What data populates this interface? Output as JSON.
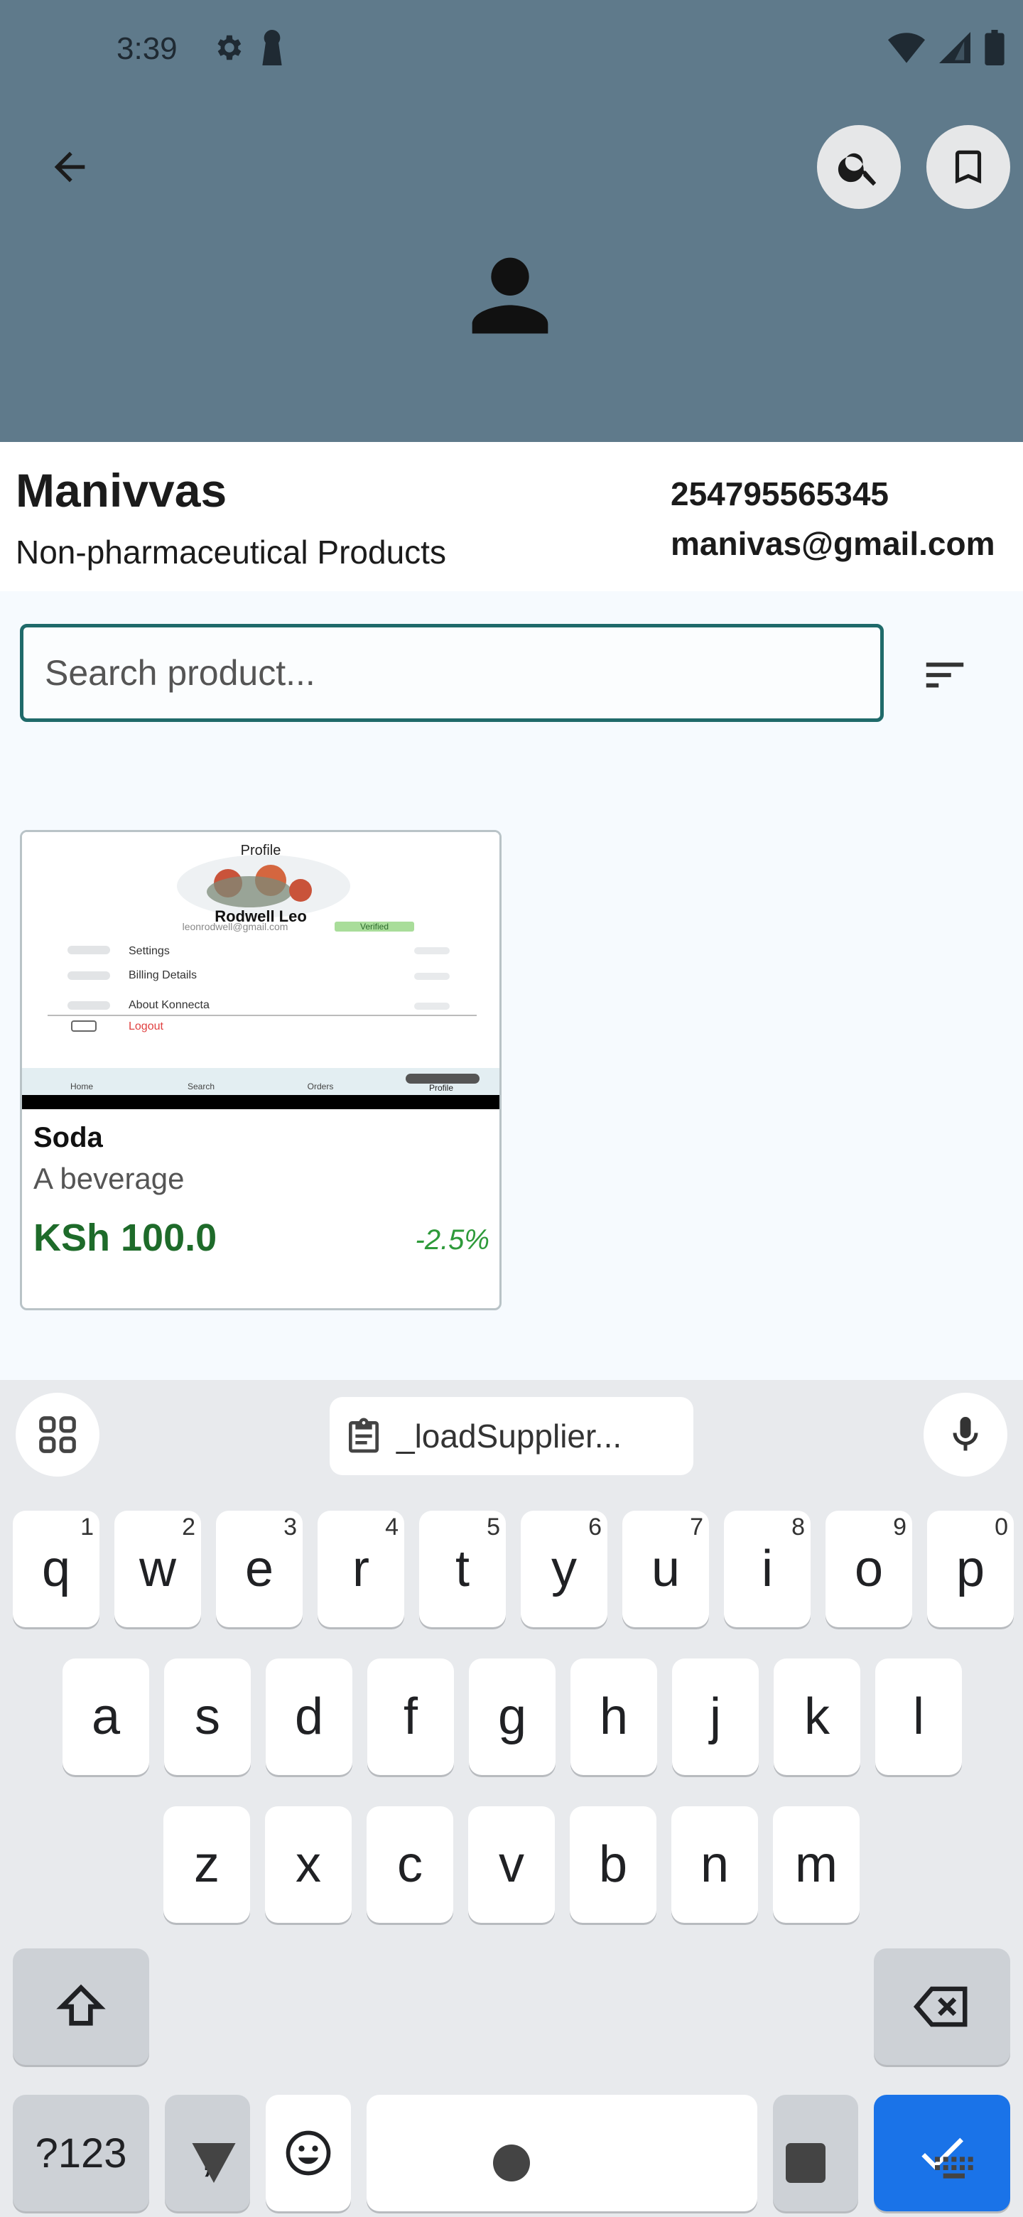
{
  "status_bar": {
    "time": "3:39"
  },
  "header": {
    "back_icon": "arrow-left-icon",
    "search_icon": "search-icon",
    "bookmark_icon": "bookmark-icon",
    "avatar_icon": "person-icon",
    "background": "#5f7a8b"
  },
  "supplier": {
    "name": "Manivvas",
    "category": "Non-pharmaceutical Products",
    "phone": "254795565345",
    "email": "manivas@gmail.com"
  },
  "search": {
    "placeholder": "Search product...",
    "value": "",
    "accent": "#1f6a6a"
  },
  "products": [
    {
      "title": "Soda",
      "description": "A beverage",
      "price": "KSh 100.0",
      "discount": "-2.5%",
      "thumb": {
        "header": "Profile",
        "user": "Rodwell Leo",
        "email": "leonrodwell@gmail.com",
        "badge": "Verified",
        "menu": [
          "Settings",
          "Billing Details",
          "About Konnecta",
          "Logout"
        ],
        "tabs": [
          "Home",
          "Search",
          "Orders",
          "Profile"
        ]
      }
    }
  ],
  "keyboard": {
    "clipboard_chip": "_loadSupplier...",
    "row1": [
      {
        "k": "q",
        "h": "1"
      },
      {
        "k": "w",
        "h": "2"
      },
      {
        "k": "e",
        "h": "3"
      },
      {
        "k": "r",
        "h": "4"
      },
      {
        "k": "t",
        "h": "5"
      },
      {
        "k": "y",
        "h": "6"
      },
      {
        "k": "u",
        "h": "7"
      },
      {
        "k": "i",
        "h": "8"
      },
      {
        "k": "o",
        "h": "9"
      },
      {
        "k": "p",
        "h": "0"
      }
    ],
    "row2": [
      "a",
      "s",
      "d",
      "f",
      "g",
      "h",
      "j",
      "k",
      "l"
    ],
    "row3": [
      "z",
      "x",
      "c",
      "v",
      "b",
      "n",
      "m"
    ],
    "symbols_label": "?123",
    "comma": ",",
    "period": ".",
    "action_color": "#1a73e8"
  }
}
